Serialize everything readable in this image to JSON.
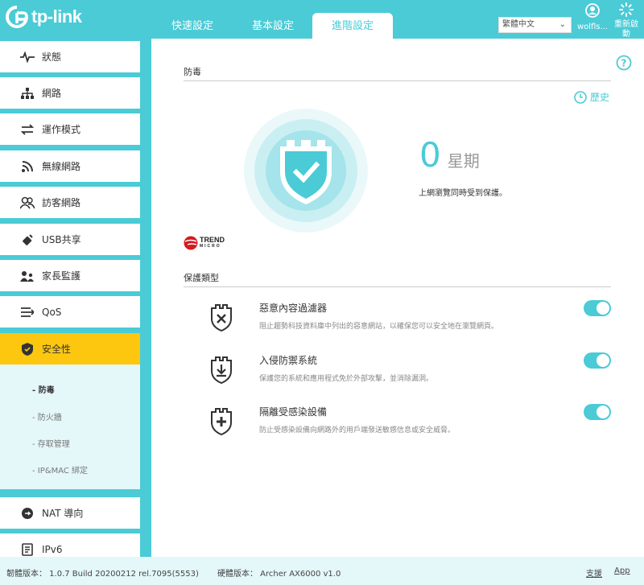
{
  "brand": {
    "name": "tp-link"
  },
  "tabs": [
    {
      "label": "快速設定"
    },
    {
      "label": "基本設定"
    },
    {
      "label": "進階設定"
    }
  ],
  "header": {
    "language": "繁體中文",
    "user": "wolfls...",
    "reboot_line1": "重新啟",
    "reboot_line2": "動"
  },
  "sidebar": {
    "items": [
      {
        "label": "狀態",
        "icon": "status-pulse-icon"
      },
      {
        "label": "網路",
        "icon": "network-icon"
      },
      {
        "label": "運作模式",
        "icon": "operation-mode-icon"
      },
      {
        "label": "無線網路",
        "icon": "wireless-icon"
      },
      {
        "label": "訪客網路",
        "icon": "guest-icon"
      },
      {
        "label": "USB共享",
        "icon": "usb-icon"
      },
      {
        "label": "家長監護",
        "icon": "parental-icon"
      },
      {
        "label": "QoS",
        "icon": "qos-icon"
      },
      {
        "label": "安全性",
        "icon": "security-shield-icon"
      },
      {
        "label": "NAT 導向",
        "icon": "nat-icon"
      },
      {
        "label": "IPv6",
        "icon": "ipv6-icon"
      }
    ],
    "submenu": [
      {
        "label": "- 防毒"
      },
      {
        "label": "- 防火牆"
      },
      {
        "label": "- 存取管理"
      },
      {
        "label": "- IP&MAC 綁定"
      }
    ]
  },
  "main": {
    "section_antivirus": "防毒",
    "history_label": "歷史",
    "count": "0",
    "count_unit": "星期",
    "protected_text": "上網瀏覽同時受到保護。",
    "trend_brand": "TREND",
    "trend_sub": "MICRO",
    "section_protection": "保護類型",
    "protections": [
      {
        "title": "惡意內容過濾器",
        "desc": "阻止趨勢科技資料庫中列出的惡意網站，以確保您可以安全地在瀏覽網頁。",
        "enabled": true
      },
      {
        "title": "入侵防禦系統",
        "desc": "保護您的系統和應用程式免於外部攻擊，並消除漏洞。",
        "enabled": true
      },
      {
        "title": "隔離受感染設備",
        "desc": "防止受感染設備向網路外的用戶端發送敏感信息或安全威脅。",
        "enabled": true
      }
    ]
  },
  "footer": {
    "firmware": "韌體版本： 1.0.7 Build 20200212 rel.7095(5553)",
    "hardware": "硬體版本： Archer AX6000 v1.0",
    "support": "支援",
    "app": "App"
  },
  "colors": {
    "accent": "#4acbd6",
    "active": "#fdc70f",
    "submenu_bg": "#e4f7f9"
  }
}
